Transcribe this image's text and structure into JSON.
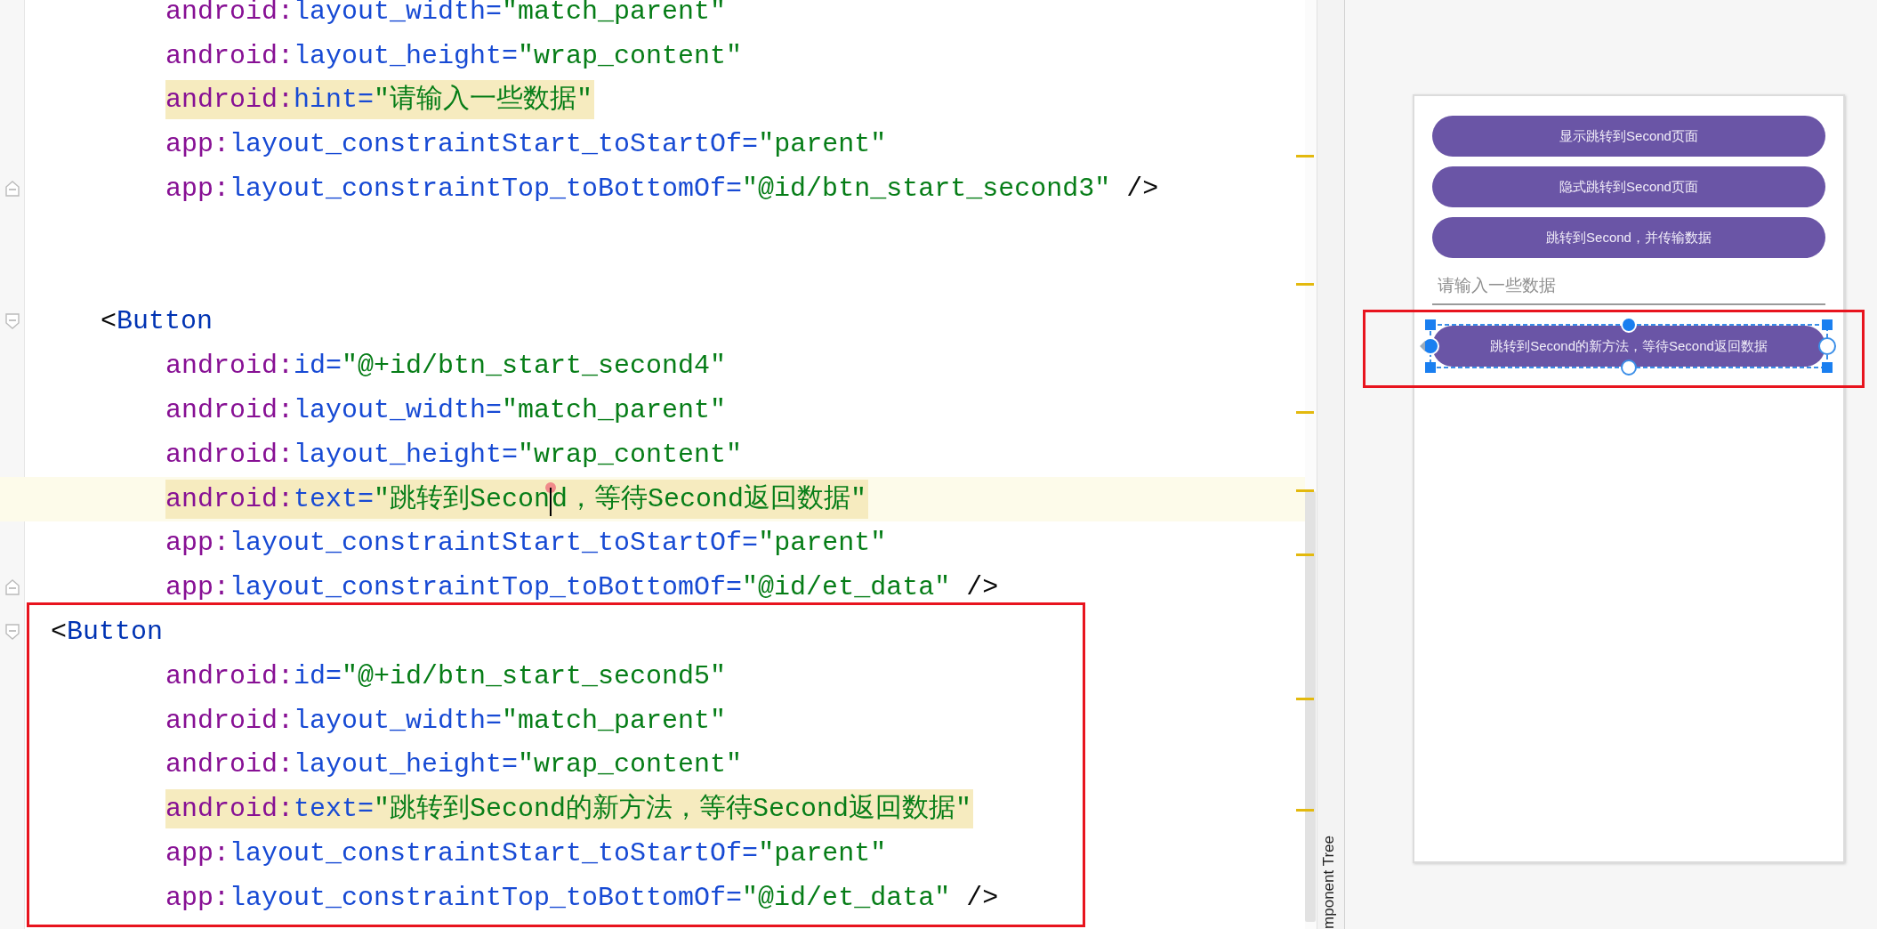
{
  "editor": {
    "blocks": [
      {
        "lines": [
          {
            "kind": "attribute",
            "tokens": [
              {
                "kind": "ns",
                "text": "android:"
              },
              {
                "kind": "attr",
                "text": "layout_width="
              },
              {
                "kind": "val",
                "text": "\"match_parent\""
              }
            ]
          },
          {
            "kind": "attribute",
            "tokens": [
              {
                "kind": "ns",
                "text": "android:"
              },
              {
                "kind": "attr",
                "text": "layout_height="
              },
              {
                "kind": "val",
                "text": "\"wrap_content\""
              }
            ]
          },
          {
            "kind": "attribute",
            "highlight": true,
            "tokens": [
              {
                "kind": "ns",
                "text": "android:"
              },
              {
                "kind": "attr",
                "text": "hint="
              },
              {
                "kind": "val",
                "text": "\"请输入一些数据\""
              }
            ]
          },
          {
            "kind": "attribute",
            "tokens": [
              {
                "kind": "ns",
                "text": "app:"
              },
              {
                "kind": "attr",
                "text": "layout_constraintStart_toStartOf="
              },
              {
                "kind": "val",
                "text": "\"parent\""
              }
            ]
          },
          {
            "kind": "attribute",
            "fold_end": true,
            "tokens": [
              {
                "kind": "ns",
                "text": "app:"
              },
              {
                "kind": "attr",
                "text": "layout_constraintTop_toBottomOf="
              },
              {
                "kind": "val",
                "text": "\"@id/btn_start_second3\""
              },
              {
                "kind": "punct",
                "text": " />"
              }
            ]
          },
          {
            "kind": "blank"
          },
          {
            "kind": "blank"
          }
        ]
      },
      {
        "lines": [
          {
            "kind": "tag_indented",
            "fold_start": true,
            "tokens": [
              {
                "kind": "punct",
                "text": "<"
              },
              {
                "kind": "tag",
                "text": "Button"
              }
            ]
          },
          {
            "kind": "attribute",
            "tokens": [
              {
                "kind": "ns",
                "text": "android:"
              },
              {
                "kind": "attr",
                "text": "id="
              },
              {
                "kind": "val",
                "text": "\"@+id/btn_start_second4\""
              }
            ]
          },
          {
            "kind": "attribute",
            "tokens": [
              {
                "kind": "ns",
                "text": "android:"
              },
              {
                "kind": "attr",
                "text": "layout_width="
              },
              {
                "kind": "val",
                "text": "\"match_parent\""
              }
            ]
          },
          {
            "kind": "attribute",
            "tokens": [
              {
                "kind": "ns",
                "text": "android:"
              },
              {
                "kind": "attr",
                "text": "layout_height="
              },
              {
                "kind": "val",
                "text": "\"wrap_content\""
              }
            ]
          },
          {
            "kind": "attribute",
            "highlight": true,
            "current": true,
            "tokens": [
              {
                "kind": "ns",
                "text": "android:"
              },
              {
                "kind": "attr",
                "text": "text="
              },
              {
                "kind": "val",
                "text": "\"跳转到Secon",
                "caret_after": true
              },
              {
                "kind": "val",
                "text": "d，等待Second返回数据\""
              }
            ]
          },
          {
            "kind": "attribute",
            "tokens": [
              {
                "kind": "ns",
                "text": "app:"
              },
              {
                "kind": "attr",
                "text": "layout_constraintStart_toStartOf="
              },
              {
                "kind": "val",
                "text": "\"parent\""
              }
            ]
          },
          {
            "kind": "attribute",
            "fold_end": true,
            "tokens": [
              {
                "kind": "ns",
                "text": "app:"
              },
              {
                "kind": "attr",
                "text": "layout_constraintTop_toBottomOf="
              },
              {
                "kind": "val",
                "text": "\"@id/et_data\""
              },
              {
                "kind": "punct",
                "text": " />"
              }
            ]
          }
        ]
      },
      {
        "boxed": true,
        "lines": [
          {
            "kind": "tag_flush",
            "fold_start": true,
            "tokens": [
              {
                "kind": "punct",
                "text": "<"
              },
              {
                "kind": "tag",
                "text": "Button"
              }
            ]
          },
          {
            "kind": "attribute",
            "tokens": [
              {
                "kind": "ns",
                "text": "android:"
              },
              {
                "kind": "attr",
                "text": "id="
              },
              {
                "kind": "val",
                "text": "\"@+id/btn_start_second5\""
              }
            ]
          },
          {
            "kind": "attribute",
            "tokens": [
              {
                "kind": "ns",
                "text": "android:"
              },
              {
                "kind": "attr",
                "text": "layout_width="
              },
              {
                "kind": "val",
                "text": "\"match_parent\""
              }
            ]
          },
          {
            "kind": "attribute",
            "tokens": [
              {
                "kind": "ns",
                "text": "android:"
              },
              {
                "kind": "attr",
                "text": "layout_height="
              },
              {
                "kind": "val",
                "text": "\"wrap_content\""
              }
            ]
          },
          {
            "kind": "attribute",
            "highlight": true,
            "tokens": [
              {
                "kind": "ns",
                "text": "android:"
              },
              {
                "kind": "attr",
                "text": "text="
              },
              {
                "kind": "val",
                "text": "\"跳转到Second的新方法，等待Second返回数据\""
              }
            ]
          },
          {
            "kind": "attribute",
            "tokens": [
              {
                "kind": "ns",
                "text": "app:"
              },
              {
                "kind": "attr",
                "text": "layout_constraintStart_toStartOf="
              },
              {
                "kind": "val",
                "text": "\"parent\""
              }
            ]
          },
          {
            "kind": "attribute",
            "tokens": [
              {
                "kind": "ns",
                "text": "app:"
              },
              {
                "kind": "attr",
                "text": "layout_constraintTop_toBottomOf="
              },
              {
                "kind": "val",
                "text": "\"@id/et_data\""
              },
              {
                "kind": "punct",
                "text": " />"
              }
            ]
          }
        ]
      }
    ]
  },
  "side_tab": {
    "label": "mponent Tree"
  },
  "preview": {
    "widgets": [
      {
        "kind": "button",
        "text": "显示跳转到Second页面",
        "selected": false
      },
      {
        "kind": "button",
        "text": "隐式跳转到Second页面",
        "selected": false
      },
      {
        "kind": "button",
        "text": "跳转到Second，并传输数据",
        "selected": false
      },
      {
        "kind": "edit",
        "placeholder": "请输入一些数据"
      },
      {
        "kind": "button",
        "text": "跳转到Second的新方法，等待Second返回数据",
        "selected": true,
        "annotated": true
      }
    ]
  }
}
